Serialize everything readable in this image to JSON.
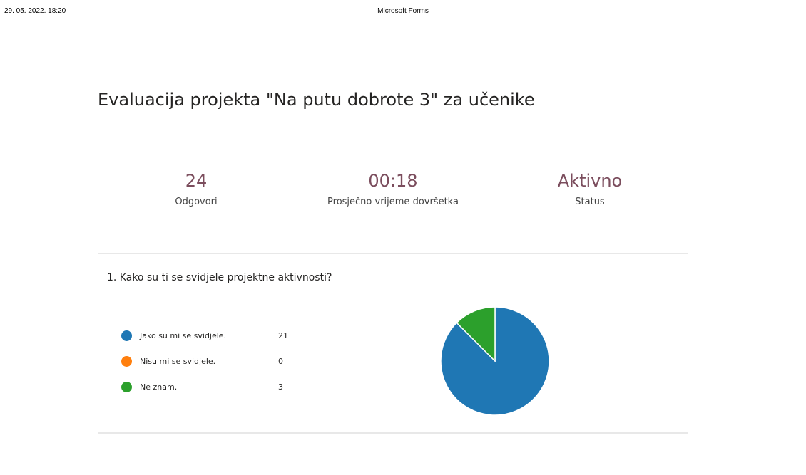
{
  "print_header": {
    "datetime": "29. 05. 2022. 18:20",
    "app_title": "Microsoft Forms"
  },
  "form": {
    "title": "Evaluacija projekta \"Na putu dobrote 3\" za učenike"
  },
  "stats": [
    {
      "value": "24",
      "label": "Odgovori"
    },
    {
      "value": "00:18",
      "label": "Prosječno vrijeme dovršetka"
    },
    {
      "value": "Aktivno",
      "label": "Status"
    }
  ],
  "colors": {
    "stat_value": "#7b4d5d",
    "divider": "#e8e8e8"
  },
  "questions": [
    {
      "text": "1. Kako su ti se svidjele projektne aktivnosti?"
    }
  ],
  "chart_data": {
    "type": "pie",
    "categories": [
      "Jako su mi se svidjele.",
      "Nisu mi se svidjele.",
      "Ne znam."
    ],
    "values": [
      21,
      0,
      3
    ],
    "counts_text": [
      "21",
      "0",
      "3"
    ],
    "colors": [
      "#1f77b4",
      "#ff7f0e",
      "#2ca02c"
    ],
    "legend_position": "left"
  }
}
